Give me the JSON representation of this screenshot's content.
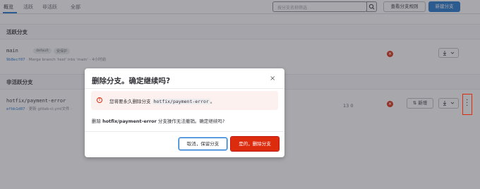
{
  "tabs": [
    {
      "label": "概览"
    },
    {
      "label": "活跃"
    },
    {
      "label": "非活跃"
    },
    {
      "label": "全部"
    }
  ],
  "search": {
    "placeholder": "按分支名称筛选"
  },
  "actions": {
    "view_rules": "查看分支规则",
    "new_branch": "新建分支"
  },
  "sections": {
    "active_title": "活跃分支",
    "inactive_title": "非活跃分支"
  },
  "branches": [
    {
      "name": "main",
      "badges": [
        "default",
        "受保护"
      ],
      "sha": "9b8ecf07",
      "commit_msg": "· Merge branch 'test' into 'main' · 4小时前"
    },
    {
      "name": "hotfix/payment-error",
      "sha": "efbb1d07",
      "commit_msg": "· 更新 gitlab-ci.yml文件 · ",
      "counts": "13 0",
      "new_label": "新增"
    }
  ],
  "modal": {
    "title": "删除分支。确定继续吗?",
    "close": "×",
    "alert_prefix": "您将要永久删除分支",
    "alert_branch": "hotfix/payment-error",
    "alert_suffix": "。",
    "body_prefix": "删除",
    "body_branch": "hotfix/payment-error",
    "body_suffix": "分支操作无法撤销。确定继续吗?",
    "cancel_label": "取消，保留分支",
    "confirm_label": "是的，删除分支"
  },
  "colors": {
    "primary": "#1f75cb",
    "danger": "#dd2b0e"
  }
}
